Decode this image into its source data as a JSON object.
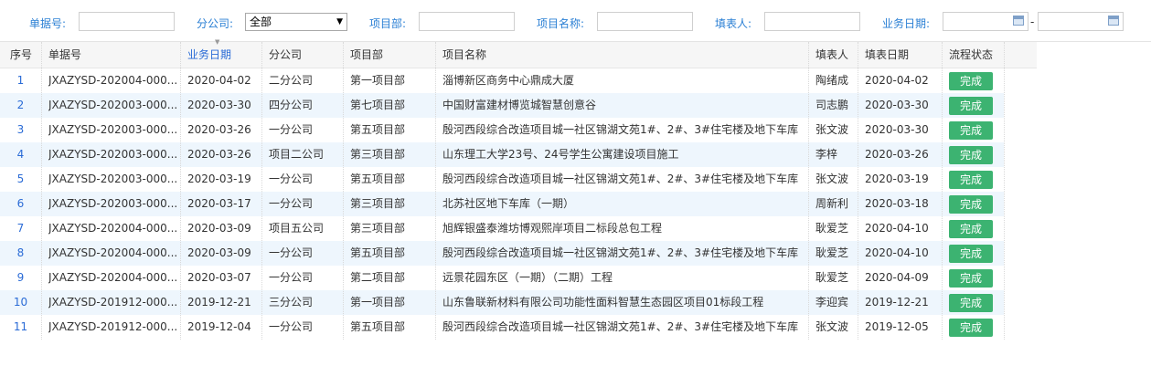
{
  "filters": {
    "doc_no_label": "单据号:",
    "branch_label": "分公司:",
    "branch_selected": "全部",
    "project_dept_label": "项目部:",
    "project_name_label": "项目名称:",
    "filler_label": "填表人:",
    "biz_date_label": "业务日期:",
    "date_separator": "-"
  },
  "table": {
    "headers": {
      "seq": "序号",
      "doc_no": "单据号",
      "biz_date": "业务日期",
      "branch": "分公司",
      "dept": "项目部",
      "project": "项目名称",
      "filler": "填表人",
      "fill_date": "填表日期",
      "status": "流程状态"
    },
    "sorted_column": "biz_date",
    "rows": [
      {
        "seq": "1",
        "doc_no": "JXAZYSD-202004-000...",
        "biz_date": "2020-04-02",
        "branch": "二分公司",
        "dept": "第一项目部",
        "project": "淄博新区商务中心鼎成大厦",
        "filler": "陶绪成",
        "fill_date": "2020-04-02",
        "status": "完成"
      },
      {
        "seq": "2",
        "doc_no": "JXAZYSD-202003-000...",
        "biz_date": "2020-03-30",
        "branch": "四分公司",
        "dept": "第七项目部",
        "project": "中国财富建材博览城智慧创意谷",
        "filler": "司志鹏",
        "fill_date": "2020-03-30",
        "status": "完成"
      },
      {
        "seq": "3",
        "doc_no": "JXAZYSD-202003-000...",
        "biz_date": "2020-03-26",
        "branch": "一分公司",
        "dept": "第五项目部",
        "project": "殷河西段综合改造项目城一社区锦湖文苑1#、2#、3#住宅楼及地下车库",
        "filler": "张文波",
        "fill_date": "2020-03-30",
        "status": "完成"
      },
      {
        "seq": "4",
        "doc_no": "JXAZYSD-202003-000...",
        "biz_date": "2020-03-26",
        "branch": "项目二公司",
        "dept": "第三项目部",
        "project": "山东理工大学23号、24号学生公寓建设项目施工",
        "filler": "李梓",
        "fill_date": "2020-03-26",
        "status": "完成"
      },
      {
        "seq": "5",
        "doc_no": "JXAZYSD-202003-000...",
        "biz_date": "2020-03-19",
        "branch": "一分公司",
        "dept": "第五项目部",
        "project": "殷河西段综合改造项目城一社区锦湖文苑1#、2#、3#住宅楼及地下车库",
        "filler": "张文波",
        "fill_date": "2020-03-19",
        "status": "完成"
      },
      {
        "seq": "6",
        "doc_no": "JXAZYSD-202003-000...",
        "biz_date": "2020-03-17",
        "branch": "一分公司",
        "dept": "第三项目部",
        "project": "北苏社区地下车库（一期）",
        "filler": "周新利",
        "fill_date": "2020-03-18",
        "status": "完成"
      },
      {
        "seq": "7",
        "doc_no": "JXAZYSD-202004-000...",
        "biz_date": "2020-03-09",
        "branch": "项目五公司",
        "dept": "第三项目部",
        "project": "旭辉银盛泰潍坊博观熙岸项目二标段总包工程",
        "filler": "耿爱芝",
        "fill_date": "2020-04-10",
        "status": "完成"
      },
      {
        "seq": "8",
        "doc_no": "JXAZYSD-202004-000...",
        "biz_date": "2020-03-09",
        "branch": "一分公司",
        "dept": "第五项目部",
        "project": "殷河西段综合改造项目城一社区锦湖文苑1#、2#、3#住宅楼及地下车库",
        "filler": "耿爱芝",
        "fill_date": "2020-04-10",
        "status": "完成"
      },
      {
        "seq": "9",
        "doc_no": "JXAZYSD-202004-000...",
        "biz_date": "2020-03-07",
        "branch": "一分公司",
        "dept": "第二项目部",
        "project": "远景花园东区（一期）（二期）工程",
        "filler": "耿爱芝",
        "fill_date": "2020-04-09",
        "status": "完成"
      },
      {
        "seq": "10",
        "doc_no": "JXAZYSD-201912-000...",
        "biz_date": "2019-12-21",
        "branch": "三分公司",
        "dept": "第一项目部",
        "project": "山东鲁联新材料有限公司功能性面料智慧生态园区项目01标段工程",
        "filler": "李迎宾",
        "fill_date": "2019-12-21",
        "status": "完成"
      },
      {
        "seq": "11",
        "doc_no": "JXAZYSD-201912-000...",
        "biz_date": "2019-12-04",
        "branch": "一分公司",
        "dept": "第五项目部",
        "project": "殷河西段综合改造项目城一社区锦湖文苑1#、2#、3#住宅楼及地下车库",
        "filler": "张文波",
        "fill_date": "2019-12-05",
        "status": "完成"
      }
    ]
  },
  "colors": {
    "accent": "#2a7fd4",
    "status_green": "#3cb371",
    "row_alt": "#eef6fd"
  }
}
